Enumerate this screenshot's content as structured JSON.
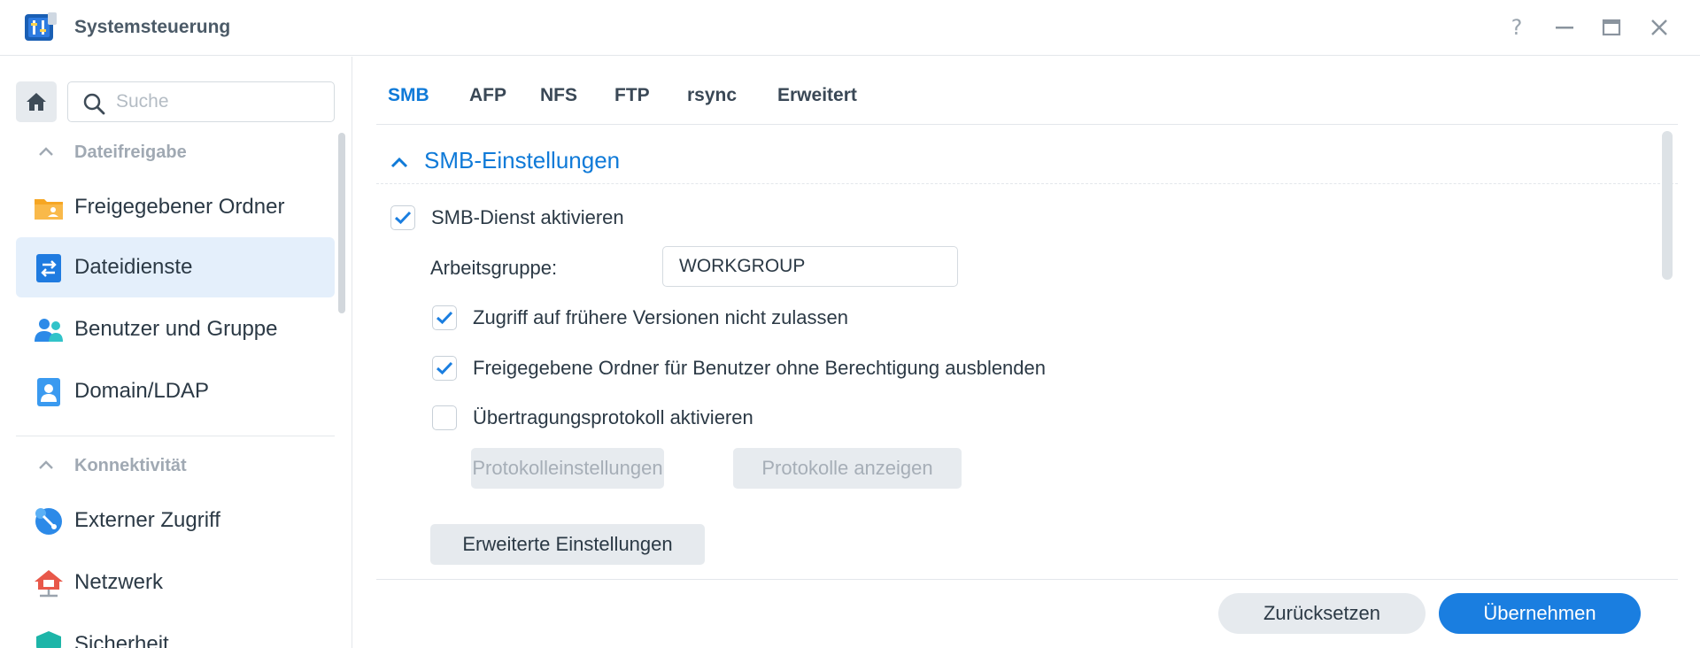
{
  "window": {
    "title": "Systemsteuerung",
    "controls": [
      "help-icon",
      "minimize-icon",
      "maximize-icon",
      "close-icon"
    ]
  },
  "sidebar": {
    "search_placeholder": "Suche",
    "sections": [
      {
        "title": "Dateifreigabe",
        "items": [
          {
            "label": "Freigegebener Ordner",
            "icon": "shared-folder-icon",
            "active": false
          },
          {
            "label": "Dateidienste",
            "icon": "file-services-icon",
            "active": true
          },
          {
            "label": "Benutzer und Gruppe",
            "icon": "users-icon",
            "active": false
          },
          {
            "label": "Domain/LDAP",
            "icon": "domain-ldap-icon",
            "active": false
          }
        ]
      },
      {
        "title": "Konnektivität",
        "items": [
          {
            "label": "Externer Zugriff",
            "icon": "external-access-icon",
            "active": false
          },
          {
            "label": "Netzwerk",
            "icon": "network-icon",
            "active": false
          },
          {
            "label": "Sicherheit",
            "icon": "security-icon",
            "active": false
          }
        ]
      }
    ]
  },
  "tabs": [
    {
      "label": "SMB",
      "active": true
    },
    {
      "label": "AFP",
      "active": false
    },
    {
      "label": "NFS",
      "active": false
    },
    {
      "label": "FTP",
      "active": false
    },
    {
      "label": "rsync",
      "active": false
    },
    {
      "label": "Erweitert",
      "active": false
    }
  ],
  "smb": {
    "section_title": "SMB-Einstellungen",
    "enable_label": "SMB-Dienst aktivieren",
    "enable_checked": true,
    "workgroup_label": "Arbeitsgruppe:",
    "workgroup_value": "WORKGROUP",
    "options": [
      {
        "label": "Zugriff auf frühere Versionen nicht zulassen",
        "checked": true
      },
      {
        "label": "Freigegebene Ordner für Benutzer ohne Berechtigung ausblenden",
        "checked": true
      },
      {
        "label": "Übertragungsprotokoll aktivieren",
        "checked": false
      }
    ],
    "log_settings_label": "Protokolleinstellungen",
    "view_logs_label": "Protokolle anzeigen",
    "advanced_settings_label": "Erweiterte Einstellungen"
  },
  "footer": {
    "reset_label": "Zurücksetzen",
    "apply_label": "Übernehmen"
  },
  "colors": {
    "accent": "#0f7ad8",
    "primary_button": "#1a7ee0",
    "active_nav_bg": "#e4effb"
  }
}
